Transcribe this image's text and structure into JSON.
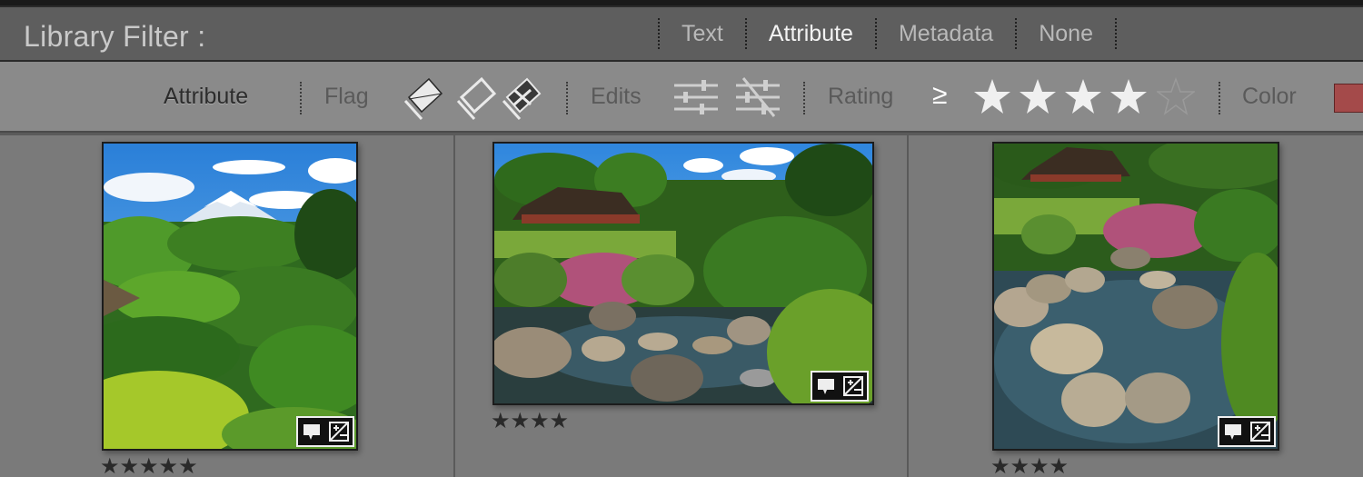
{
  "library_filter": {
    "title": "Library Filter :",
    "tabs": [
      {
        "label": "Text",
        "active": false
      },
      {
        "label": "Attribute",
        "active": true
      },
      {
        "label": "Metadata",
        "active": false
      },
      {
        "label": "None",
        "active": false
      }
    ]
  },
  "attribute_bar": {
    "attribute_label": "Attribute",
    "flag_label": "Flag",
    "edits_label": "Edits",
    "rating_label": "Rating",
    "rating_operator": "≥",
    "rating_value": 4,
    "rating_max": 5,
    "color_label": "Color",
    "color_swatch": "#a44a4a"
  },
  "thumbnails": [
    {
      "stars": "★★★★★",
      "rating": 5,
      "scene": "Mount Fuji above garden trees"
    },
    {
      "stars": "★★★★",
      "rating": 4,
      "scene": "Garden pond with stepping stones"
    },
    {
      "stars": "★★★★",
      "rating": 4,
      "scene": "Pond with stones and shrubs"
    }
  ],
  "colors": {
    "filter_bar_bg": "#5e5e5e",
    "attribute_bar_bg": "#8a8a8a",
    "grid_bg": "#7a7a7a",
    "active_tab": "#f2f2f2"
  }
}
